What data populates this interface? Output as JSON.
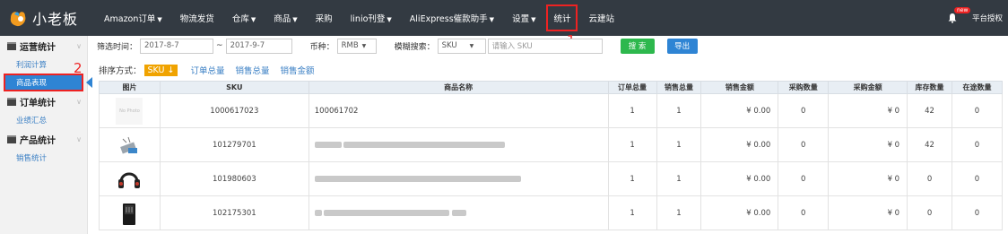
{
  "app": {
    "logo_text": "小老板"
  },
  "nav": {
    "items": [
      {
        "label": "Amazon订单",
        "caret": "▼"
      },
      {
        "label": "物流发货",
        "caret": ""
      },
      {
        "label": "仓库",
        "caret": "▼"
      },
      {
        "label": "商品",
        "caret": "▼"
      },
      {
        "label": "采购",
        "caret": ""
      },
      {
        "label": "linio刊登",
        "caret": "▼"
      },
      {
        "label": "AliExpress催款助手",
        "caret": "▼"
      },
      {
        "label": "设置",
        "caret": "▼"
      },
      {
        "label": "统计",
        "caret": ""
      },
      {
        "label": "云建站",
        "caret": ""
      }
    ],
    "annotation": "1",
    "badge": "new",
    "right_label": "平台授权"
  },
  "sidebar": {
    "annotation": "2",
    "groups": [
      {
        "title": "运营统计",
        "links": [
          "利润计算",
          "商品表现"
        ]
      },
      {
        "title": "订单统计",
        "links": [
          "业绩汇总"
        ]
      },
      {
        "title": "产品统计",
        "links": [
          "销售统计"
        ]
      }
    ]
  },
  "filters": {
    "time_label": "筛选时间：",
    "date_from": "2017-8-7",
    "tilde": "~",
    "date_to": "2017-9-7",
    "currency_label": "币种：",
    "currency_value": "RMB",
    "fuzzy_label": "模糊搜索：",
    "fuzzy_field": "SKU",
    "search_placeholder": "请输入 SKU",
    "search_button": "搜 索",
    "export_button": "导出"
  },
  "sort": {
    "label": "排序方式：",
    "active": "SKU ↓",
    "options": [
      "订单总量",
      "销售总量",
      "销售金额"
    ]
  },
  "table": {
    "headers": [
      "图片",
      "SKU",
      "商品名称",
      "订单总量",
      "销售总量",
      "销售金额",
      "采购数量",
      "采购金额",
      "库存数量",
      "在途数量"
    ],
    "rows": [
      {
        "photo": "No Photo",
        "sku": "1000617023",
        "name": "100061702",
        "orders": "1",
        "sales": "1",
        "amount": "¥ 0.00",
        "purchase_qty": "0",
        "purchase_amount": "¥ 0",
        "stock": "42",
        "transit": "0"
      },
      {
        "photo": "",
        "sku": "101279701",
        "name": "",
        "orders": "1",
        "sales": "1",
        "amount": "¥ 0.00",
        "purchase_qty": "0",
        "purchase_amount": "¥ 0",
        "stock": "42",
        "transit": "0"
      },
      {
        "photo": "",
        "sku": "101980603",
        "name": "",
        "orders": "1",
        "sales": "1",
        "amount": "¥ 0.00",
        "purchase_qty": "0",
        "purchase_amount": "¥ 0",
        "stock": "0",
        "transit": "0"
      },
      {
        "photo": "",
        "sku": "102175301",
        "name": "",
        "orders": "1",
        "sales": "1",
        "amount": "¥ 0.00",
        "purchase_qty": "0",
        "purchase_amount": "¥ 0",
        "stock": "0",
        "transit": "0"
      }
    ]
  },
  "colors": {
    "topbar": "#333a42",
    "accent_blue": "#2e84d4",
    "search_green": "#2db84d",
    "sort_orange": "#f0a300",
    "annotation_red": "#e22222"
  }
}
